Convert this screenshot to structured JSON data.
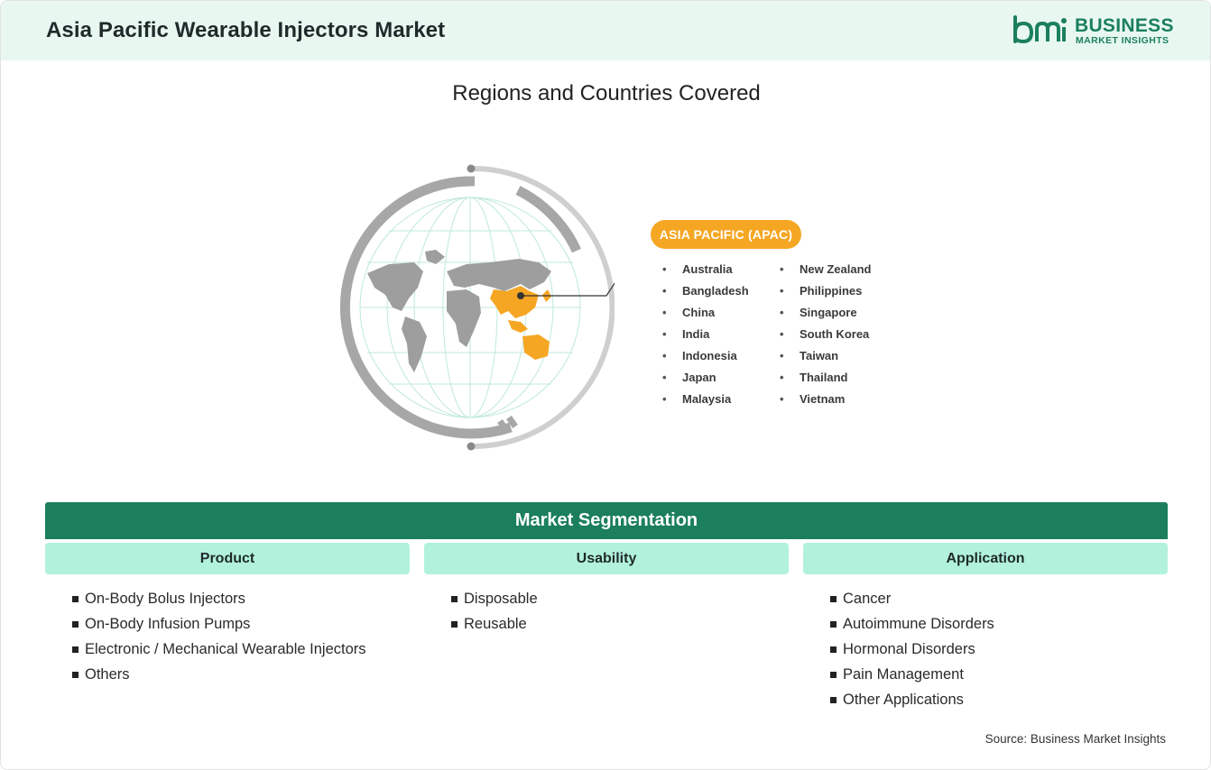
{
  "header": {
    "title": "Asia Pacific Wearable Injectors Market",
    "logo": {
      "line1": "BUSINESS",
      "line2": "MARKET INSIGHTS",
      "mark": "bmi"
    }
  },
  "regions": {
    "title": "Regions and Countries Covered",
    "region_label": "ASIA PACIFIC (APAC)",
    "countries_col1": [
      "Australia",
      "Bangladesh",
      "China",
      "India",
      "Indonesia",
      "Japan",
      "Malaysia"
    ],
    "countries_col2": [
      "New Zealand",
      "Philippines",
      "Singapore",
      "South Korea",
      "Taiwan",
      "Thailand",
      "Vietnam"
    ]
  },
  "segmentation": {
    "title": "Market Segmentation",
    "columns": [
      {
        "header": "Product",
        "items": [
          "On-Body Bolus Injectors",
          "On-Body Infusion Pumps",
          "Electronic / Mechanical Wearable Injectors",
          "Others"
        ]
      },
      {
        "header": "Usability",
        "items": [
          "Disposable",
          "Reusable"
        ]
      },
      {
        "header": "Application",
        "items": [
          "Cancer",
          "Autoimmune Disorders",
          "Hormonal Disorders",
          "Pain Management",
          "Other Applications"
        ]
      }
    ]
  },
  "source": "Source: Business Market Insights",
  "colors": {
    "brand": "#1b7f5e",
    "header_bg": "#e8f8f1",
    "accent": "#f5a623",
    "subheader_bg": "#b2f2dc",
    "map_gray": "#9e9e9e"
  },
  "icons": [
    "globe-icon",
    "world-map-icon",
    "bmi-logo-icon"
  ]
}
